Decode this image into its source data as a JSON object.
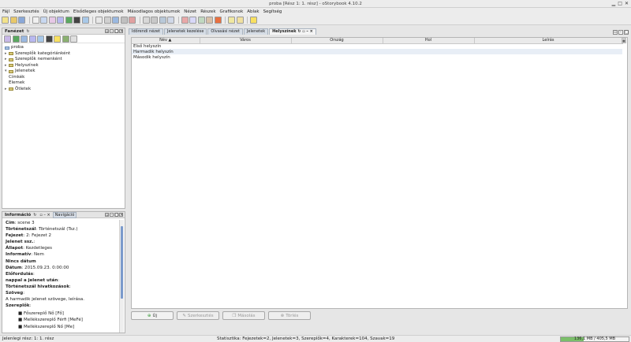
{
  "window": {
    "title": "proba [Rész 1: 1. rész] - oStorybook 4.10.2"
  },
  "menu": [
    "Fájl",
    "Szerkesztés",
    "Új objektum",
    "Elsődleges objektumok",
    "Másodlagos objektumok",
    "Nézet",
    "Részek",
    "Grafikonok",
    "Ablak",
    "Segítség"
  ],
  "tree_panel": {
    "title": "Fanézet",
    "items": [
      {
        "label": "proba",
        "level": 0,
        "expander": ""
      },
      {
        "label": "Szereplők kategóriánként",
        "level": 1,
        "expander": "▸"
      },
      {
        "label": "Szereplők nemenként",
        "level": 1,
        "expander": "▸"
      },
      {
        "label": "Helyszínek",
        "level": 1,
        "expander": "▸"
      },
      {
        "label": "Jelenetek",
        "level": 1,
        "expander": "▾"
      },
      {
        "label": "Címkék",
        "level": 1,
        "expander": ""
      },
      {
        "label": "Elemek",
        "level": 1,
        "expander": ""
      },
      {
        "label": "Ötletek",
        "level": 1,
        "expander": "▸"
      }
    ]
  },
  "info_panel": {
    "title": "Információ",
    "tab2": "Navigáció",
    "rows": [
      {
        "label": "Cím",
        "value": "scene 3"
      },
      {
        "label": "Történetszál",
        "value": "Történetszál (Tsz.)"
      },
      {
        "label": "Fejezet",
        "value": "2: Fejezet 2"
      },
      {
        "label": "Jelenet ssz.",
        "value": ""
      },
      {
        "label": "Állapot",
        "value": "Kezdetleges"
      },
      {
        "label": "Informatív",
        "value": "Nem"
      },
      {
        "label": "Nincs dátum",
        "value": ""
      },
      {
        "label": "Dátum",
        "value": "2015.09.23. 0:00:00"
      },
      {
        "label": "Előfordulás",
        "value": ""
      },
      {
        "label": "nappal a jelenet után",
        "value": ""
      },
      {
        "label": "Történetszál hivatkozások",
        "value": ""
      },
      {
        "label": "Szöveg",
        "value": ""
      },
      {
        "label": "",
        "value": "A harmadik jelenet szövege, leírása."
      },
      {
        "label": "Szereplők",
        "value": ""
      }
    ],
    "bullets": [
      "Főszereplő Nő [Fő]",
      "Mellékszereplő Férfi [MeFé]",
      "Mellékszereplő Nő [Me]"
    ]
  },
  "tabs": [
    "Időrendi nézet",
    "Jelenetek kezelése",
    "Olvasási nézet",
    "Jelenetek",
    "Helyszínek"
  ],
  "table": {
    "columns": [
      "Név ▲",
      "Város",
      "Ország",
      "Hol",
      "Leírás"
    ],
    "rows": [
      [
        "Első helyszín",
        "",
        "",
        "",
        ""
      ],
      [
        "Harmadik helyszín",
        "",
        "",
        "",
        ""
      ],
      [
        "Második helyszín",
        "",
        "",
        "",
        ""
      ]
    ]
  },
  "buttons": {
    "new": "Új",
    "edit": "Szerkesztés",
    "copy": "Másolás",
    "delete": "Törlés"
  },
  "status": {
    "left": "Jelenlegi rész: 1: 1. rész",
    "stats": "Statisztika: Fejezetek=2,  Jelenetek=3,  Szereplők=4,  Karakterek=104,  Szavak=19",
    "memory": "136,1 MB / 405,5 MB",
    "memory_fraction": 0.34
  },
  "colors": {
    "accent": "#3a6fb0",
    "memory_bar": "#7bbf6a",
    "tab_bg": "#d6dde6"
  }
}
